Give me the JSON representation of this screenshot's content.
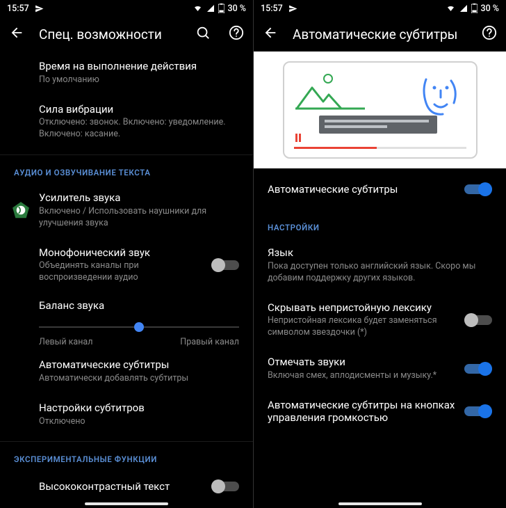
{
  "status": {
    "time": "15:57",
    "battery_text": "30 %"
  },
  "left": {
    "appbar": {
      "title": "Спец. возможности"
    },
    "rows": {
      "action_timeout": {
        "primary": "Время на выполнение действия",
        "secondary": "По умолчанию"
      },
      "vibration": {
        "primary": "Сила вибрации",
        "secondary": "Отключено: звонок. Включено: уведомление. Включено: касание."
      }
    },
    "section_audio": "АУДИО И ОЗВУЧИВАНИЕ ТЕКСТА",
    "sound_amp": {
      "primary": "Усилитель звука",
      "secondary": "Включено / Использовать наушники для улучшения звука"
    },
    "mono": {
      "primary": "Монофонический звук",
      "secondary": "Объединять каналы при воспроизведении аудио"
    },
    "balance": {
      "primary": "Баланс звука",
      "left": "Левый канал",
      "right": "Правый канал"
    },
    "auto_captions": {
      "primary": "Автоматические субтитры",
      "secondary": "Автоматически добавлять субтитры"
    },
    "caption_settings": {
      "primary": "Настройки субтитров",
      "secondary": "Отключено"
    },
    "section_exp": "ЭКСПЕРИМЕНТАЛЬНЫЕ ФУНКЦИИ",
    "high_contrast": {
      "primary": "Высококонтрастный текст"
    }
  },
  "right": {
    "appbar": {
      "title": "Автоматические субтитры"
    },
    "master": {
      "primary": "Автоматические субтитры"
    },
    "section_settings": "НАСТРОЙКИ",
    "language": {
      "primary": "Язык",
      "secondary": "Пока доступен только английский язык. Скоро мы добавим поддержку других языков."
    },
    "profanity": {
      "primary": "Скрывать непристойную лексику",
      "secondary": "Непристойная лексика будет заменяться символом звездочки (*)"
    },
    "label_sounds": {
      "primary": "Отмечать звуки",
      "secondary": "Включая смех, аплодисменты и музыку.*"
    },
    "volume_btn": {
      "primary": "Автоматические субтитры на кнопках управления громкостью"
    }
  },
  "icon_names": {
    "send": "send-icon",
    "wifi": "wifi-icon",
    "signal": "signal-icon",
    "battery": "battery-icon",
    "back": "back-icon",
    "search": "search-icon",
    "help": "help-icon",
    "sound_amp": "accessibility-sound-amplifier-icon"
  },
  "switches": {
    "mono": false,
    "high_contrast": false,
    "master": true,
    "profanity": false,
    "label_sounds": true,
    "volume_btn": true
  },
  "slider": {
    "position_pct": 50
  },
  "colors": {
    "accent": "#1a73e8",
    "header": "#5a8fd6"
  }
}
